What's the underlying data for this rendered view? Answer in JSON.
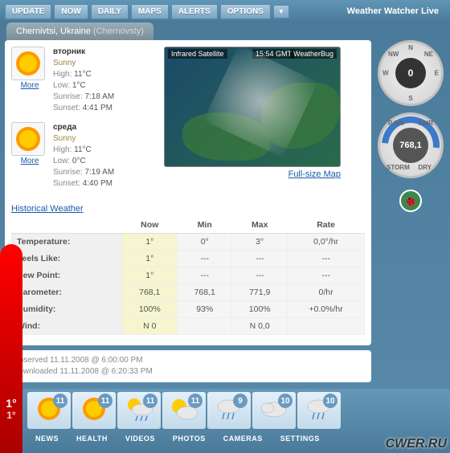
{
  "app": {
    "title": "Weather Watcher Live"
  },
  "nav": {
    "update": "UPDATE",
    "now": "NOW",
    "daily": "DAILY",
    "maps": "MAPS",
    "alerts": "ALERTS",
    "options": "OPTIONS",
    "dropdown": "▼"
  },
  "location": {
    "city": "Chernivtsi, Ukraine",
    "alt": "(Chernovsty)"
  },
  "forecast": [
    {
      "day": "вторник",
      "cond": "Sunny",
      "high_lbl": "High:",
      "high": "11°C",
      "low_lbl": "Low:",
      "low": "1°C",
      "sunrise_lbl": "Sunrise:",
      "sunrise": "7:18 AM",
      "sunset_lbl": "Sunset:",
      "sunset": "4:41 PM",
      "more": "More"
    },
    {
      "day": "среда",
      "cond": "Sunny",
      "high_lbl": "High:",
      "high": "11°C",
      "low_lbl": "Low:",
      "low": "0°C",
      "sunrise_lbl": "Sunrise:",
      "sunrise": "7:19 AM",
      "sunset_lbl": "Sunset:",
      "sunset": "4:40 PM",
      "more": "More"
    }
  ],
  "map": {
    "title": "Infrared Satellite",
    "time": "15:54 GMT",
    "source": "WeatherBug",
    "full_link": "Full-size Map"
  },
  "historical_link": "Historical Weather",
  "stats": {
    "headers": {
      "now": "Now",
      "min": "Min",
      "max": "Max",
      "rate": "Rate"
    },
    "rows": [
      {
        "label": "Temperature:",
        "now": "1°",
        "min": "0°",
        "max": "3°",
        "rate": "0,0°/hr"
      },
      {
        "label": "Feels Like:",
        "now": "1°",
        "min": "---",
        "max": "---",
        "rate": "---"
      },
      {
        "label": "Dew Point:",
        "now": "1°",
        "min": "---",
        "max": "---",
        "rate": "---"
      },
      {
        "label": "Barometer:",
        "now": "768,1",
        "min": "768,1",
        "max": "771,9",
        "rate": "0/hr"
      },
      {
        "label": "Humidity:",
        "now": "100%",
        "min": "93%",
        "max": "100%",
        "rate": "+0.0%/hr"
      },
      {
        "label": "Wind:",
        "now": "N 0",
        "min": "",
        "max": "N 0,0",
        "rate": ""
      }
    ]
  },
  "gauges": {
    "wind": {
      "value": "0",
      "n": "N",
      "s": "S",
      "e": "E",
      "w": "W",
      "ne": "NE",
      "nw": "NW"
    },
    "baro": {
      "value": "768,1",
      "rain": "RAIN",
      "fair": "FAIR",
      "storm": "STORM",
      "dry": "DRY"
    }
  },
  "meta": {
    "observed": "Observed 11.11.2008 @ 6:00:00 PM",
    "downloaded": "Downloaded 11.11.2008 @ 6:20:33 PM"
  },
  "current_temp": {
    "main": "1°",
    "feels": "1°"
  },
  "days": [
    {
      "t": "11",
      "icon": "sun"
    },
    {
      "t": "11",
      "icon": "sun"
    },
    {
      "t": "11",
      "icon": "partly-rain"
    },
    {
      "t": "11",
      "icon": "partly"
    },
    {
      "t": "9",
      "icon": "rain"
    },
    {
      "t": "10",
      "icon": "cloudy"
    },
    {
      "t": "10",
      "icon": "rain"
    }
  ],
  "bottom_nav": {
    "news": "NEWS",
    "health": "HEALTH",
    "videos": "VIDEOS",
    "photos": "PHOTOS",
    "cameras": "CAMERAS",
    "settings": "SETTINGS"
  },
  "watermark": "CWER.RU"
}
